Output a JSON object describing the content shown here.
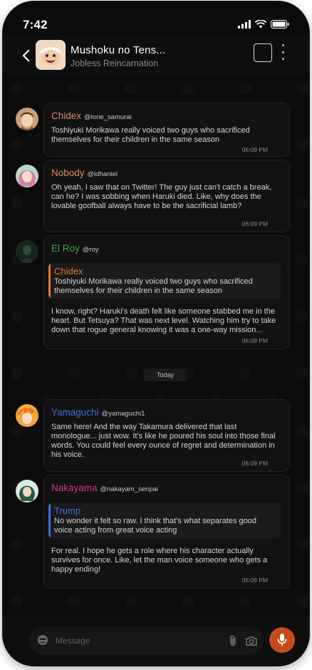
{
  "status": {
    "time": "7:42"
  },
  "header": {
    "title": "Mushoku no Tens...",
    "subtitle": "Jobless Reincarnation",
    "back_icon": "chevron-left-icon",
    "more_icon": "more-vertical-icon"
  },
  "messages": [
    {
      "name": "Chidex",
      "handle": "@lone_samurai",
      "name_color": "#d98b5a",
      "text": "Toshiyuki Morikawa really voiced two guys who sacrificed themselves for their children in the same season",
      "time": "06:09 PM"
    },
    {
      "name": "Nobody",
      "handle": "@idhaniel",
      "name_color": "#d98b5a",
      "text": "Oh yeah, I saw that on Twitter! The guy just can't catch a break, can he? I was sobbing when Haruki died. Like, why does the lovable goofball always have to be the sacrificial lamb?",
      "time": "06:09 PM"
    },
    {
      "name": "El Roy",
      "handle": "@roy",
      "name_color": "#3fa63c",
      "quote": {
        "name": "Chidex",
        "name_color": "#e0762f",
        "bar_color": "#e0762f",
        "text": "Toshiyuki Morikawa really voiced two guys who sacrificed themselves for their children in the same season"
      },
      "text": "I know, right? Haruki's death felt like someone stabbed me in the heart. But Tetsuya? That was next level. Watching him try to take down that rogue general knowing it was a one-way mission...",
      "time": "06:09 PM"
    },
    {
      "name": "Yamaguchi",
      "handle": "@yamaguchi1",
      "name_color": "#3f6fd8",
      "text": "Same here! And the way Takamura delivered that last monologue... just wow. It's like he poured his soul into those final words. You could feel every ounce of regret and determination in his voice.",
      "time": "06:09 PM"
    },
    {
      "name": "Nakayama",
      "handle": "@nakayam_senpai",
      "name_color": "#c93a8a",
      "quote": {
        "name": "Trump",
        "name_color": "#3f6fd8",
        "bar_color": "#3f6fd8",
        "text": "No wonder it felt so raw. I think that's what separates good voice acting from great voice acting"
      },
      "text": "For real. I hope he gets a role where his character actually survives for once. Like, let the man voice someone who gets a happy ending!",
      "time": "06:09 PM"
    }
  ],
  "date_divider": "Today",
  "composer": {
    "placeholder": "Message",
    "mic_color": "#c44b1a"
  }
}
